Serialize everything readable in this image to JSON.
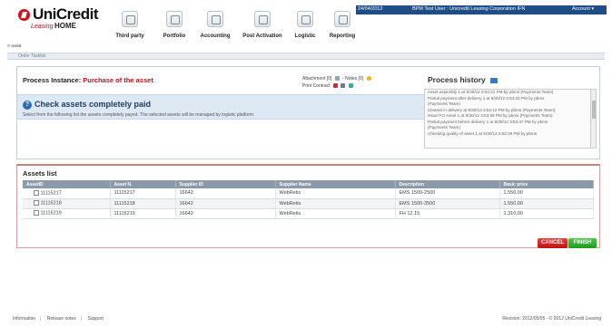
{
  "header": {
    "brand": "UniCredit",
    "brand_sub": "Leasing",
    "home_label": "HOME",
    "brand_color": "#d4101d"
  },
  "nav": [
    {
      "label": "Third party",
      "icon": "third-party-icon"
    },
    {
      "label": "Portfolio",
      "icon": "portfolio-icon"
    },
    {
      "label": "Accounting",
      "icon": "accounting-icon"
    },
    {
      "label": "Post Activation",
      "icon": "post-activation-icon"
    },
    {
      "label": "Logistic",
      "icon": "logistic-icon"
    },
    {
      "label": "Reporting",
      "icon": "reporting-icon"
    }
  ],
  "topbar": {
    "date": "24/04/2012",
    "user": "BPM Test User : Unicredit Leasing Corporation IFN",
    "account": "Account ▾",
    "color": "#1f4e86"
  },
  "subheader": {
    "label": "≡ aaaa",
    "crumb": "Order Tasklist"
  },
  "process": {
    "label": "Process Instance:",
    "name": "Purchase of the asset",
    "attachments": "Attachment [0]",
    "notes": "Notes [0]",
    "print_contract": "Print Contract"
  },
  "banner": {
    "title": "Check assets completely paid",
    "text": "Select from the following list the assets completely payed. The selected assets will be managed by logistic platform."
  },
  "history": {
    "title": "Process history",
    "lines": [
      "Asset assembly 1 at 9/30/12 3:54:21 PM by pbms (Payments Team)",
      "Partial payment after delivery 1 at 9/30/12 3:54:20 PM by pbms",
      "(Payments Team)",
      "Cleared in delivery at 9/30/12 3:54:12 PM by pbms (Payments Team)",
      "Issue PO Asset 1 at 9/30/12 3:53:59 PM by pbms (Payments Team)",
      "Partial payment before delivery 1 at 9/30/12 3:53:47 PM by pbms",
      "(Payments Team)",
      "Checking quality of asset 1 at 9/30/12 3:53:29 PM by pbms"
    ]
  },
  "assets": {
    "title": "Assets list",
    "columns": [
      "AssetID",
      "Asset N.",
      "Supplier ID",
      "Supplier Name",
      "Description",
      "Basic price"
    ],
    "rows": [
      [
        "11115217",
        "11115217",
        "16642",
        "WebRetis",
        "EMS 1500-2500",
        "1.550,00"
      ],
      [
        "11115218",
        "11115218",
        "16642",
        "WebRetis",
        "EMS 1500-3500",
        "1.550,00"
      ],
      [
        "11115219",
        "11115219",
        "16642",
        "WebRetis",
        "FH 12.15",
        "1.310,00"
      ]
    ]
  },
  "buttons": {
    "cancel": "CANCEL",
    "finish": "FINISH"
  },
  "footer": {
    "links": [
      "Information",
      "Release notes",
      "Support"
    ],
    "right": "Revision: 2012/05/05 - © 2012 UniCredit Leasing"
  }
}
